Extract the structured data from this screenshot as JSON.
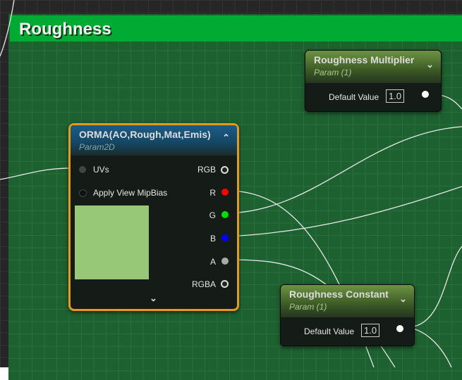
{
  "comment": {
    "title": "Roughness",
    "color": "#00aa33"
  },
  "nodes": {
    "multiplier": {
      "title": "Roughness Multiplier",
      "subtitle": "Param (1)",
      "input_label": "Default Value",
      "value": "1.0"
    },
    "orma": {
      "title": "ORMA(AO,Rough,Mat,Emis)",
      "subtitle": "Param2D",
      "inputs": [
        "UVs",
        "Apply View MipBias"
      ],
      "outputs": [
        "RGB",
        "R",
        "G",
        "B",
        "A",
        "RGBA"
      ],
      "preview_color": "#96c878"
    },
    "constant": {
      "title": "Roughness Constant",
      "subtitle": "Param (1)",
      "input_label": "Default Value",
      "value": "1.0"
    }
  }
}
